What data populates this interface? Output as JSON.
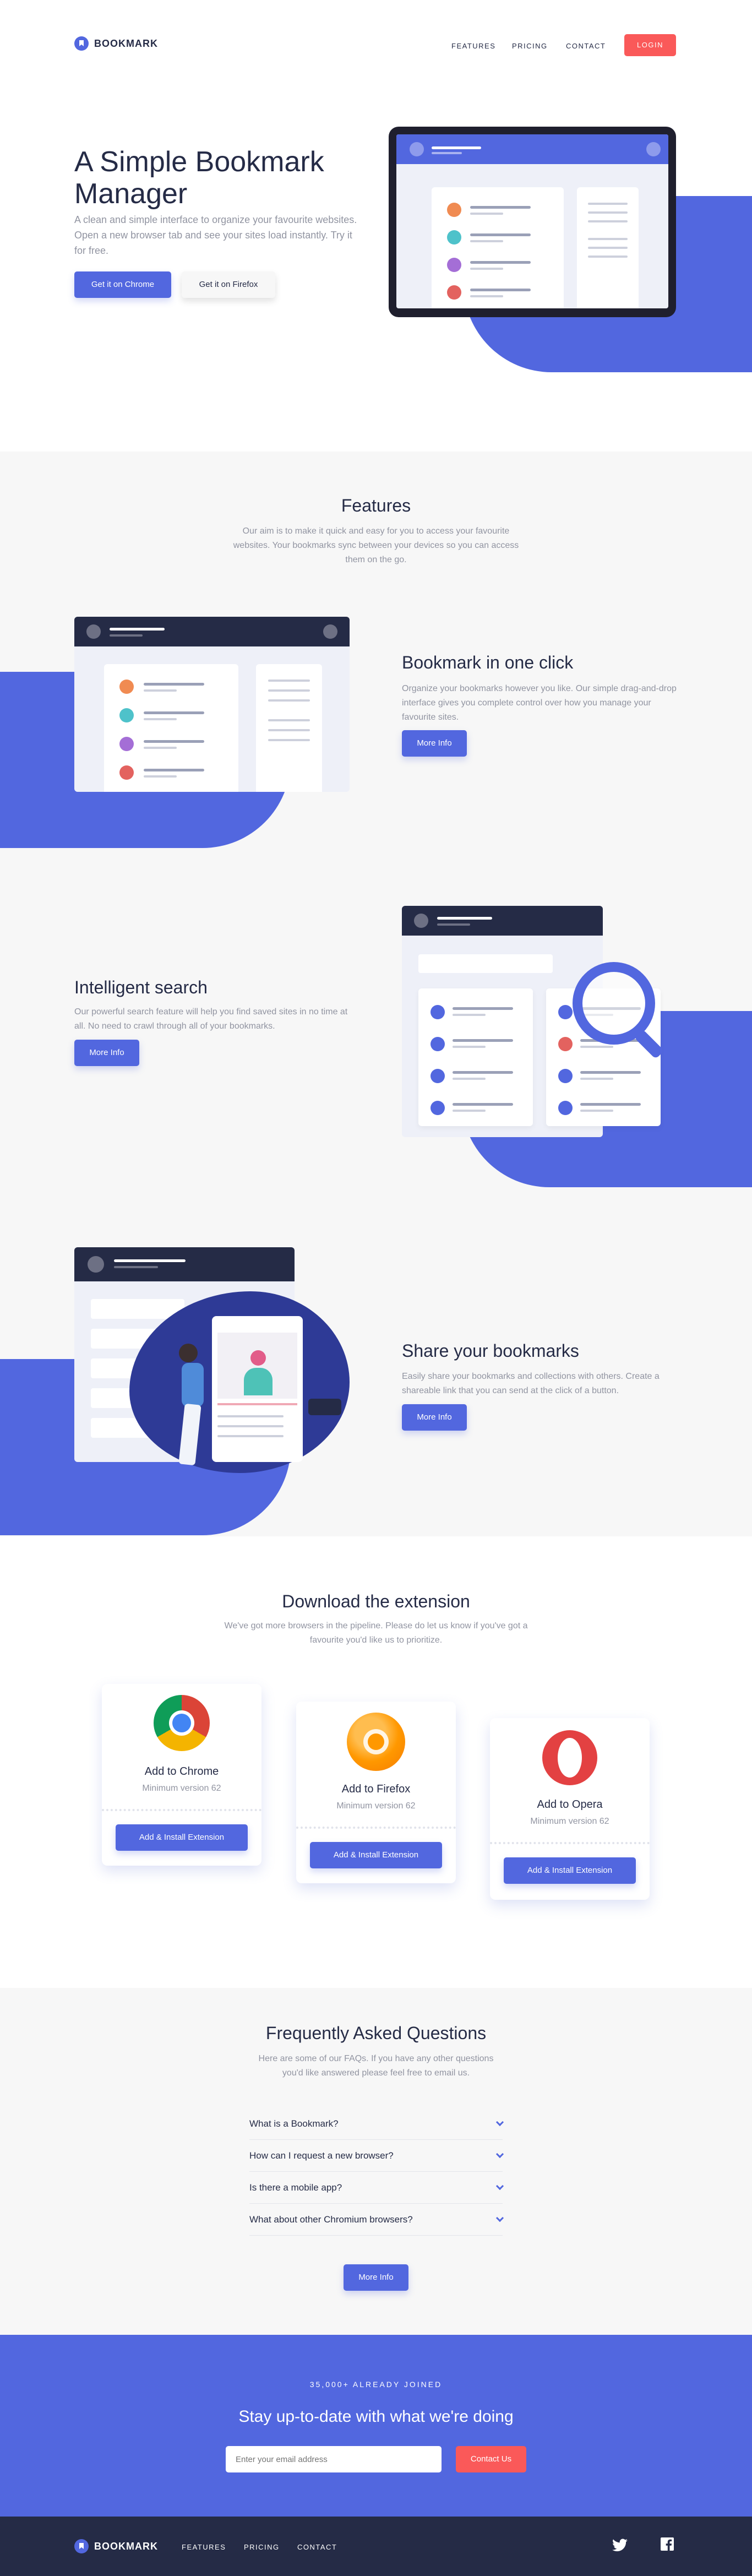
{
  "nav": {
    "brand": "BOOKMARK",
    "links": [
      "FEATURES",
      "PRICING",
      "CONTACT"
    ],
    "login": "LOGIN"
  },
  "hero": {
    "title": "A Simple Bookmark Manager",
    "text": "A clean and simple interface to organize your favourite websites. Open a new browser tab and see your sites load instantly. Try it for free.",
    "btn_chrome": "Get it on Chrome",
    "btn_firefox": "Get it on Firefox"
  },
  "features": {
    "title": "Features",
    "intro": "Our aim is to make it quick and easy for you to access your favourite websites. Your bookmarks sync between your devices so you can access them on the go.",
    "items": [
      {
        "title": "Bookmark in one click",
        "text": "Organize your bookmarks however you like. Our simple drag-and-drop interface gives you complete control over how you manage your favourite sites.",
        "btn": "More Info"
      },
      {
        "title": "Intelligent search",
        "text": "Our powerful search feature will help you find saved sites in no time at all. No need to crawl through all of your bookmarks.",
        "btn": "More Info"
      },
      {
        "title": "Share your bookmarks",
        "text": "Easily share your bookmarks and collections with others. Create a shareable link that you can send at the click of a button.",
        "btn": "More Info"
      }
    ]
  },
  "download": {
    "title": "Download the extension",
    "intro": "We've got more browsers in the pipeline. Please do let us know if you've got a favourite you'd like us to prioritize.",
    "cards": [
      {
        "title": "Add to Chrome",
        "version": "Minimum version 62",
        "btn": "Add & Install Extension",
        "icon": "chrome-icon"
      },
      {
        "title": "Add to Firefox",
        "version": "Minimum version 62",
        "btn": "Add & Install Extension",
        "icon": "firefox-icon"
      },
      {
        "title": "Add to Opera",
        "version": "Minimum version 62",
        "btn": "Add & Install Extension",
        "icon": "opera-icon"
      }
    ]
  },
  "faq": {
    "title": "Frequently Asked Questions",
    "intro": "Here are some of our FAQs. If you have any other questions you'd like answered please feel free to email us.",
    "items": [
      "What is a Bookmark?",
      "How can I request a new browser?",
      "Is there a mobile app?",
      "What about other Chromium browsers?"
    ],
    "btn": "More Info"
  },
  "newsletter": {
    "count": "35,000+ ALREADY JOINED",
    "title": "Stay up-to-date with what we're doing",
    "placeholder": "Enter your email address",
    "btn": "Contact Us"
  },
  "footer": {
    "brand": "BOOKMARK",
    "links": [
      "FEATURES",
      "PRICING",
      "CONTACT"
    ],
    "social": [
      "facebook-icon",
      "twitter-icon"
    ]
  },
  "colors": {
    "primary": "#5267DF",
    "red": "#FA5959",
    "navy": "#252B46",
    "gray": "#9194A1"
  }
}
